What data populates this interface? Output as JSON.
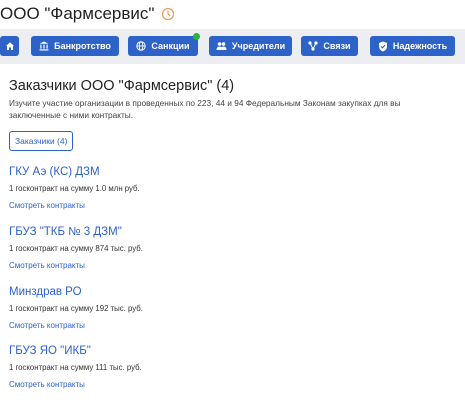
{
  "header": {
    "company_title": "ООО \"Фармсервис\"",
    "refresh_icon": "refresh-icon"
  },
  "nav": {
    "buttons": [
      {
        "label": "",
        "icon": "home-icon"
      },
      {
        "label": "Банкротство",
        "icon": "bank-icon"
      },
      {
        "label": "Санкции",
        "icon": "globe-icon"
      },
      {
        "label": "Учредители",
        "icon": "people-icon"
      },
      {
        "label": "Связи",
        "icon": "links-icon"
      },
      {
        "label": "Надежность",
        "icon": "shield-icon"
      }
    ],
    "status_dot_color": "#28b33d",
    "button_color": "#2d62c8"
  },
  "section": {
    "title": "Заказчики ООО \"Фармсервис\" (4)",
    "description_line1": "Изучите участие организации в проведенных по 223, 44 и 94 Федеральным Законам закупках для вы",
    "description_line2": "заключенные с ними контракты.",
    "filter_chip": "Заказчики (4)"
  },
  "customers": [
    {
      "name": "ГКУ Аэ (КС) ДЗМ",
      "info": "1 госконтракт на сумму 1.0 млн руб.",
      "link": "Смотреть контракты"
    },
    {
      "name": "ГБУЗ \"ТКБ № 3 ДЗМ\"",
      "info": "1 госконтракт на сумму 874 тыс. руб.",
      "link": "Смотреть контракты"
    },
    {
      "name": "Минздрав РО",
      "info": "1 госконтракт на сумму 192 тыс. руб.",
      "link": "Смотреть контракты"
    },
    {
      "name": "ГБУЗ ЯО \"ИКБ\"",
      "info": "1 госконтракт на сумму 111 тыс. руб.",
      "link": "Смотреть контракты"
    }
  ]
}
